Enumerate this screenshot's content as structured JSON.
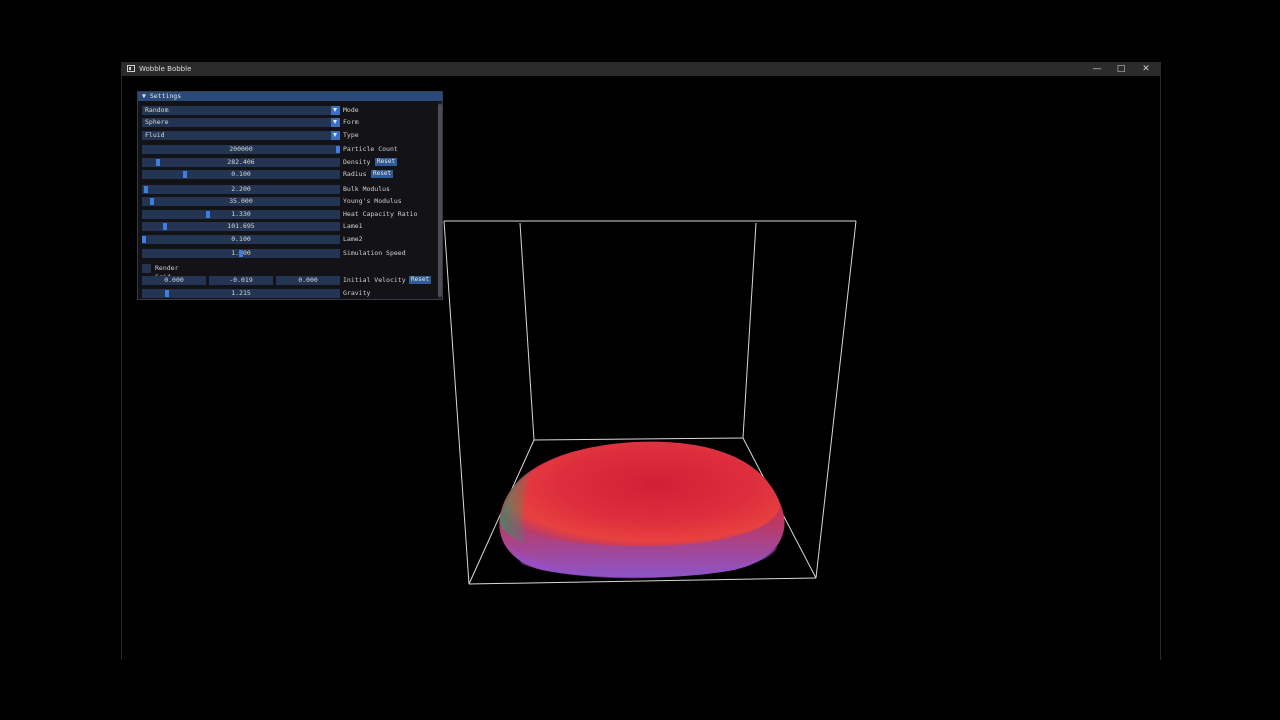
{
  "window": {
    "title": "Wobble Bobble",
    "minimize_icon": "minimize-icon",
    "maximize_icon": "maximize-icon",
    "close_icon": "close-icon",
    "min_glyph": "—",
    "max_glyph": "□",
    "close_glyph": "✕"
  },
  "settings": {
    "header": "▼ Settings",
    "dropdowns": [
      {
        "value": "Random",
        "label": "Mode"
      },
      {
        "value": "Sphere",
        "label": "Form"
      },
      {
        "value": "Fluid",
        "label": "Type"
      }
    ],
    "particle_count": {
      "value": "200000",
      "label": "Particle Count",
      "fill": 1.0
    },
    "density": {
      "value": "282.406",
      "label": "Density",
      "reset": "Reset",
      "fill": 0.07
    },
    "radius": {
      "value": "0.100",
      "label": "Radius",
      "reset": "Reset",
      "fill": 0.21
    },
    "bulk_modulus": {
      "value": "2.200",
      "label": "Bulk Modulus",
      "fill": 0.01
    },
    "youngs_modulus": {
      "value": "35.000",
      "label": "Young's Modulus",
      "fill": 0.04
    },
    "heat_capacity_ratio": {
      "value": "1.330",
      "label": "Heat Capacity Ratio",
      "fill": 0.33
    },
    "lame1": {
      "value": "101.695",
      "label": "Lame1",
      "fill": 0.11
    },
    "lame2": {
      "value": "0.100",
      "label": "Lame2",
      "fill": 0.0
    },
    "simulation_speed": {
      "value": "1.000",
      "label": "Simulation Speed",
      "fill": 0.5
    },
    "render_grid": {
      "label": "Render Grid",
      "checked": false
    },
    "initial_velocity": {
      "label": "Initial Velocity",
      "reset": "Reset",
      "values": [
        "0.000",
        "-0.019",
        "0.000"
      ]
    },
    "gravity": {
      "value": "1.215",
      "label": "Gravity",
      "fill": 0.12
    }
  },
  "colors": {
    "accent": "#3d7fe0",
    "field_bg": "#233552",
    "header_bg": "#294a7a",
    "fluid_primary": "#d8283a",
    "fluid_edge": "#9a4fc8",
    "fluid_highlight": "#2a9a6a"
  }
}
